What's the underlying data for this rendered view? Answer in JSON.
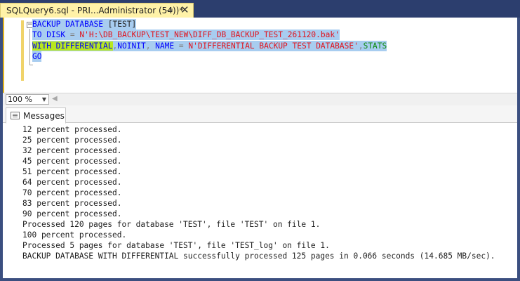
{
  "tab": {
    "title": "SQLQuery6.sql - PRI...Administrator (54))*",
    "pin": "⇥",
    "close": "✕"
  },
  "editor": {
    "collapse_glyph": "−",
    "lines": [
      {
        "kw1": "BACKUP DATABASE",
        "rest": " [TEST]"
      },
      {
        "kw1": "TO DISK",
        "op": " = ",
        "str": "N'H:\\DB_BACKUP\\TEST_NEW\\DIFF_DB_BACKUP_TEST_261120.bak'"
      },
      {
        "kw1": "WITH DIFFERENTIAL",
        "op1": ",",
        "kw2": "NOINIT",
        "op2": ", ",
        "kw3": "NAME",
        "op3": " = ",
        "str": "N'DIFFERENTIAL BACKUP TEST DATABASE'",
        "op4": ",",
        "kw4": "STATS"
      },
      {
        "kw1": "GO"
      }
    ]
  },
  "zoom": {
    "value": "100 %",
    "arrow": "▼",
    "scroll_left": "◀"
  },
  "results": {
    "tab_label": "Messages",
    "messages": [
      "12 percent processed.",
      "25 percent processed.",
      "32 percent processed.",
      "45 percent processed.",
      "51 percent processed.",
      "64 percent processed.",
      "70 percent processed.",
      "83 percent processed.",
      "90 percent processed.",
      "Processed 120 pages for database 'TEST', file 'TEST' on file 1.",
      "100 percent processed.",
      "Processed 5 pages for database 'TEST', file 'TEST_log' on file 1.",
      "BACKUP DATABASE WITH DIFFERENTIAL successfully processed 125 pages in 0.066 seconds (14.685 MB/sec)."
    ]
  },
  "colors": {
    "keyword": "#0000ff",
    "string": "#e0141e",
    "selection": "#a8cdf0",
    "highlight": "#b8e81e",
    "tab_active": "#fff2a8"
  }
}
